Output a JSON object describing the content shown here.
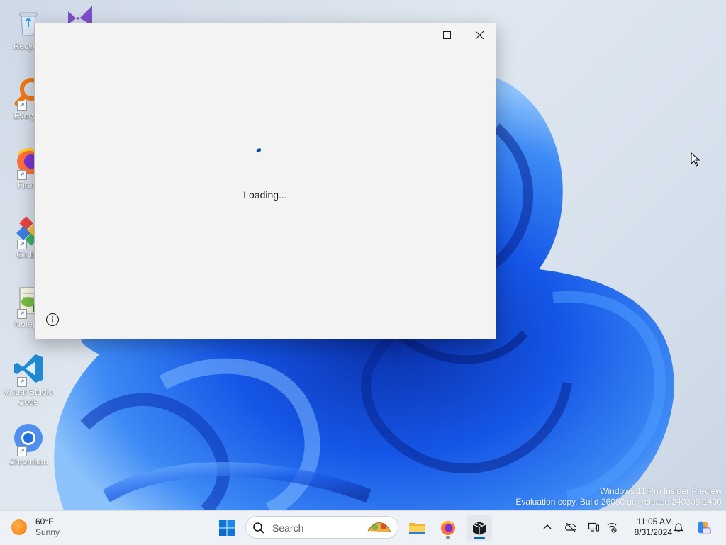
{
  "desktop": {
    "icons": [
      {
        "label": "Recycle",
        "icon": "recycle-bin-icon"
      },
      {
        "label": "Everyth",
        "icon": "everything-search-icon"
      },
      {
        "label": "Firefo",
        "icon": "firefox-icon"
      },
      {
        "label": "Git Ba",
        "icon": "git-bash-icon"
      },
      {
        "label": "Notepa",
        "icon": "notepad-plus-plus-icon"
      },
      {
        "label": "Visual Studio Code",
        "icon": "vscode-icon"
      },
      {
        "label": "Chromium",
        "icon": "chromium-icon"
      }
    ],
    "partial_icon": "visual-studio-icon"
  },
  "window": {
    "loading_text": "Loading...",
    "controls": [
      "minimize",
      "maximize",
      "close"
    ],
    "info_icon": "info-icon"
  },
  "watermark": {
    "line1": "Windows 11 Pro Insider Preview",
    "line2": "Evaluation copy. Build 26080.ge_release.240308-1400"
  },
  "taskbar": {
    "weather": {
      "temp": "60°F",
      "condition": "Sunny"
    },
    "search_placeholder": "Search",
    "apps": [
      "start-icon",
      "file-explorer-icon",
      "firefox-icon",
      "package-app-icon"
    ],
    "tray": [
      "chevron-up-icon",
      "onedrive-icon",
      "display-icon",
      "network-icon"
    ],
    "clock": {
      "time": "11:05 AM",
      "date": "8/31/2024"
    },
    "notification_icon": "bell-icon",
    "copilot_icon": "copilot-icon"
  },
  "colors": {
    "accent": "#0067c0",
    "window_bg": "#f3f3f3",
    "wallpaper_blue": "#1e5fe0"
  }
}
